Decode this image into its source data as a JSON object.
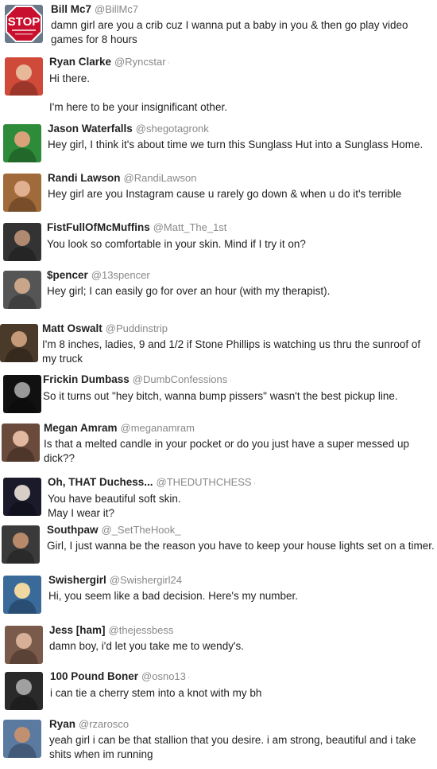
{
  "tweets": [
    {
      "name": "Bill Mc7",
      "handle": "@BillMc7",
      "dot": "",
      "text": "damn girl are you a crib cuz I wanna put a baby in you & then go play video games for 8 hours",
      "avatar_icon": "stop-sign-icon",
      "avatar_colors": [
        "#c8102e",
        "#ffffff"
      ]
    },
    {
      "name": "Ryan Clarke",
      "handle": "@Ryncstar",
      "dot": "·",
      "text": "Hi there.\n\nI'm here to be your insignificant other.",
      "avatar_icon": "person-photo-icon",
      "avatar_colors": [
        "#d04a3a",
        "#e8b89a"
      ]
    },
    {
      "name": "Jason Waterfalls",
      "handle": "@shegotagronk",
      "dot": "",
      "text": "Hey girl, I think it's about time we turn this Sunglass Hut into a Sunglass Home.",
      "avatar_icon": "person-photo-icon",
      "avatar_colors": [
        "#2e8b3a",
        "#d9a27a"
      ]
    },
    {
      "name": "Randi Lawson",
      "handle": "@RandiLawson",
      "dot": "",
      "text": "Hey girl are you Instagram cause u rarely go down & when u do it's terrible",
      "avatar_icon": "person-photo-icon",
      "avatar_colors": [
        "#a06a3a",
        "#e0b090"
      ]
    },
    {
      "name": "FistFullOfMcMuffins",
      "handle": "@Matt_The_1st",
      "dot": "·",
      "text": "You look so comfortable in your skin. Mind if I try it on?",
      "avatar_icon": "person-photo-icon",
      "avatar_colors": [
        "#333333",
        "#b08a70"
      ]
    },
    {
      "name": "$pencer",
      "handle": "@13spencer",
      "dot": "",
      "text": "Hey girl; I can easily go for over an hour (with my therapist).",
      "avatar_icon": "person-photo-icon",
      "avatar_colors": [
        "#555555",
        "#c9a58a"
      ]
    },
    {
      "name": "Matt Oswalt",
      "handle": "@Puddinstrip",
      "dot": "",
      "text": "I'm 8 inches, ladies, 9 and 1/2 if Stone Phillips is watching us thru the sunroof of my truck",
      "avatar_icon": "person-photo-icon",
      "avatar_colors": [
        "#4a3a2a",
        "#c49a78"
      ]
    },
    {
      "name": "Frickin Dumbass",
      "handle": "@DumbConfessions",
      "dot": "·",
      "text": "So it turns out \"hey bitch, wanna bump pissers\" wasn't the best pickup line.",
      "avatar_icon": "person-photo-icon",
      "avatar_colors": [
        "#111111",
        "#999999"
      ]
    },
    {
      "name": "Megan Amram",
      "handle": "@meganamram",
      "dot": "",
      "text": "Is that a melted candle in your pocket or do you just have a super messed up dick??",
      "avatar_icon": "person-photo-icon",
      "avatar_colors": [
        "#6a4a3a",
        "#e2b8a0"
      ]
    },
    {
      "name": "Oh, THAT Duchess...",
      "handle": "@THEDUTHCHESS",
      "dot": "·",
      "text": "You have beautiful soft skin.\nMay I wear it?",
      "avatar_icon": "person-photo-icon",
      "avatar_colors": [
        "#1a1a2a",
        "#d8d0c8"
      ]
    },
    {
      "name": "Southpaw",
      "handle": "@_SetTheHook_",
      "dot": "",
      "text": "Girl, I just wanna be the reason you have to keep your house lights set on a timer.",
      "avatar_icon": "person-photo-icon",
      "avatar_colors": [
        "#3a3a3a",
        "#b88a6a"
      ]
    },
    {
      "name": "Swishergirl",
      "handle": "@Swishergirl24",
      "dot": "",
      "text": "Hi, you seem like a bad decision. Here's my number.",
      "avatar_icon": "person-photo-icon",
      "avatar_colors": [
        "#3a6a9a",
        "#f0d8a0"
      ]
    },
    {
      "name": "Jess [ham]",
      "handle": "@thejessbess",
      "dot": "",
      "text": "damn boy, i'd let you take me to wendy's.",
      "avatar_icon": "person-photo-icon",
      "avatar_colors": [
        "#7a5a4a",
        "#d8b098"
      ]
    },
    {
      "name": "100 Pound Boner",
      "handle": "@osno13",
      "dot": "·",
      "text": "i can tie a cherry stem into a knot with my bh",
      "avatar_icon": "person-photo-icon",
      "avatar_colors": [
        "#2a2a2a",
        "#a0a0a0"
      ]
    },
    {
      "name": "Ryan",
      "handle": "@rzarosco",
      "dot": "",
      "text": "yeah girl i can be that stallion that you desire. i am strong, beautiful and i take shits when im running",
      "avatar_icon": "person-photo-icon",
      "avatar_colors": [
        "#5a7aa0",
        "#c09070"
      ]
    }
  ]
}
